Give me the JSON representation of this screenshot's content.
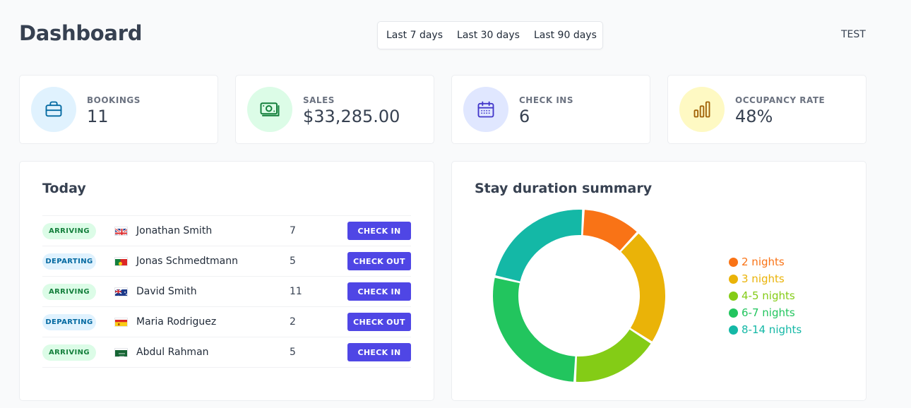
{
  "header": {
    "title": "Dashboard",
    "ranges": [
      "Last 7 days",
      "Last 30 days",
      "Last 90 days"
    ],
    "user": "TEST"
  },
  "stats": [
    {
      "label": "BOOKINGS",
      "value": "11",
      "icon": "briefcase-icon",
      "bg": "#e0f2fe",
      "color": "#0369a1"
    },
    {
      "label": "SALES",
      "value": "$33,285.00",
      "icon": "money-icon",
      "bg": "#dcfce7",
      "color": "#15803d"
    },
    {
      "label": "CHECK INS",
      "value": "6",
      "icon": "calendar-icon",
      "bg": "#e0e7ff",
      "color": "#4338ca"
    },
    {
      "label": "OCCUPANCY RATE",
      "value": "48%",
      "icon": "bar-chart-icon",
      "bg": "#fef9c3",
      "color": "#a16207"
    }
  ],
  "today": {
    "title": "Today",
    "rows": [
      {
        "status": "ARRIVING",
        "flag": "gb-flag-icon",
        "name": "Jonathan Smith",
        "nights": "7",
        "action": "CHECK IN"
      },
      {
        "status": "DEPARTING",
        "flag": "pt-flag-icon",
        "name": "Jonas Schmedtmann",
        "nights": "5",
        "action": "CHECK OUT"
      },
      {
        "status": "ARRIVING",
        "flag": "au-flag-icon",
        "name": "David Smith",
        "nights": "11",
        "action": "CHECK IN"
      },
      {
        "status": "DEPARTING",
        "flag": "es-flag-icon",
        "name": "Maria Rodriguez",
        "nights": "2",
        "action": "CHECK OUT"
      },
      {
        "status": "ARRIVING",
        "flag": "sa-flag-icon",
        "name": "Abdul Rahman",
        "nights": "5",
        "action": "CHECK IN"
      }
    ]
  },
  "summary": {
    "title": "Stay duration summary",
    "chart_data": {
      "type": "pie",
      "series": [
        {
          "name": "2 nights",
          "value": 1,
          "color": "#f97316"
        },
        {
          "name": "3 nights",
          "value": 2,
          "color": "#eab308"
        },
        {
          "name": "4-5 nights",
          "value": 1.5,
          "color": "#84cc16"
        },
        {
          "name": "6-7 nights",
          "value": 2.5,
          "color": "#22c55e"
        },
        {
          "name": "8-14 nights",
          "value": 2,
          "color": "#14b8a6"
        }
      ]
    }
  }
}
